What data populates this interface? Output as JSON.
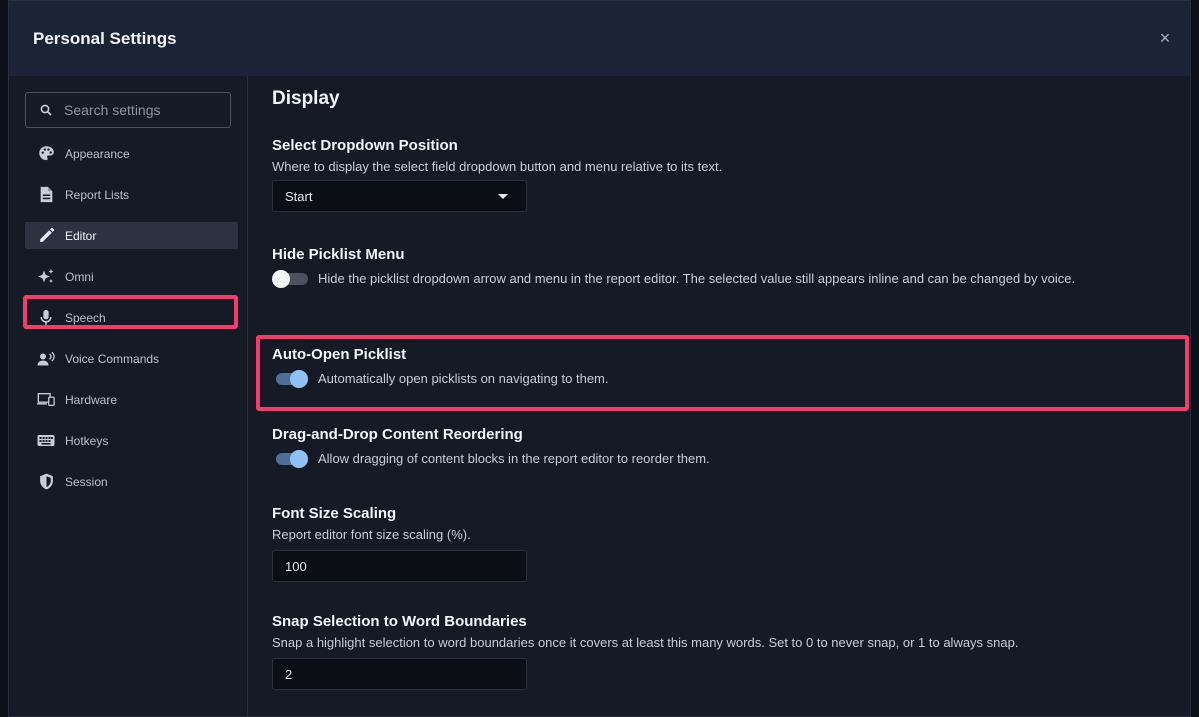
{
  "header": {
    "title": "Personal Settings",
    "close_glyph": "×"
  },
  "search": {
    "placeholder": "Search settings",
    "value": ""
  },
  "sidebar": {
    "items": [
      {
        "label": "Appearance",
        "icon": "palette-icon"
      },
      {
        "label": "Report Lists",
        "icon": "document-icon"
      },
      {
        "label": "Editor",
        "icon": "pencil-icon",
        "active": true
      },
      {
        "label": "Omni",
        "icon": "sparkles-icon"
      },
      {
        "label": "Speech",
        "icon": "microphone-icon"
      },
      {
        "label": "Voice Commands",
        "icon": "voice-command-icon"
      },
      {
        "label": "Hardware",
        "icon": "devices-icon"
      },
      {
        "label": "Hotkeys",
        "icon": "keyboard-icon"
      },
      {
        "label": "Session",
        "icon": "shield-icon"
      }
    ]
  },
  "main": {
    "section_title": "Display",
    "settings": {
      "dropdown_position": {
        "title": "Select Dropdown Position",
        "description": "Where to display the select field dropdown button and menu relative to its text.",
        "value": "Start"
      },
      "hide_picklist": {
        "title": "Hide Picklist Menu",
        "description": "Hide the picklist dropdown arrow and menu in the report editor. The selected value still appears inline and can be changed by voice.",
        "enabled": false
      },
      "auto_open": {
        "title": "Auto-Open Picklist",
        "description": "Automatically open picklists on navigating to them.",
        "enabled": true
      },
      "drag_drop": {
        "title": "Drag-and-Drop Content Reordering",
        "description": "Allow dragging of content blocks in the report editor to reorder them.",
        "enabled": true
      },
      "font_scaling": {
        "title": "Font Size Scaling",
        "description": "Report editor font size scaling (%).",
        "value": "100"
      },
      "snap_selection": {
        "title": "Snap Selection to Word Boundaries",
        "description": "Snap a highlight selection to word boundaries once it covers at least this many words. Set to 0 to never snap, or 1 to always snap.",
        "value": "2"
      }
    }
  },
  "colors": {
    "highlight": "#f23d6b",
    "toggle_on": "#8fc1f5",
    "header_bg": "#1b2436"
  }
}
